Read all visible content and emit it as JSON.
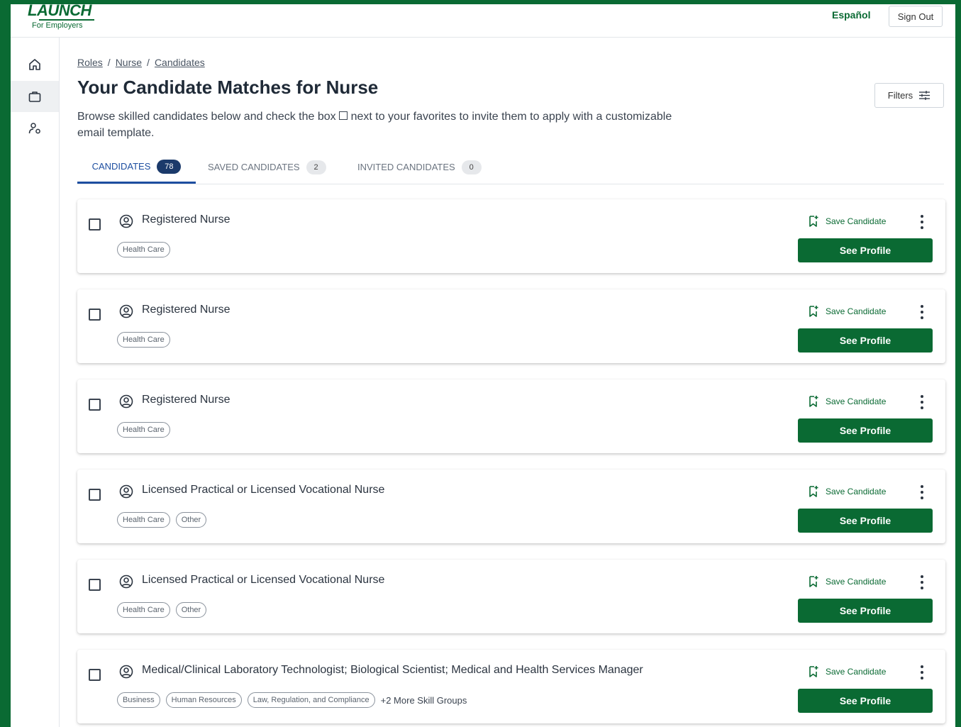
{
  "header": {
    "logo_text": "LAUNCH",
    "logo_subtitle": "For Employers",
    "language_link": "Español",
    "sign_out_label": "Sign Out"
  },
  "sidebar": {
    "items": [
      {
        "icon": "home-icon",
        "active": false
      },
      {
        "icon": "briefcase-icon",
        "active": true
      },
      {
        "icon": "user-settings-icon",
        "active": false
      }
    ]
  },
  "breadcrumb": {
    "items": [
      "Roles",
      "Nurse",
      "Candidates"
    ],
    "separator": "/"
  },
  "page": {
    "title": "Your Candidate Matches for Nurse",
    "description_before": "Browse skilled candidates below and check the box",
    "description_after": "next to your favorites to invite them to apply with a customizable email template.",
    "filters_label": "Filters"
  },
  "tabs": [
    {
      "label": "CANDIDATES",
      "count": "78",
      "active": true
    },
    {
      "label": "SAVED CANDIDATES",
      "count": "2",
      "active": false
    },
    {
      "label": "INVITED CANDIDATES",
      "count": "0",
      "active": false
    }
  ],
  "card_actions": {
    "save_label": "Save Candidate",
    "profile_label": "See Profile"
  },
  "candidates": [
    {
      "title": "Registered Nurse",
      "tags": [
        "Health Care"
      ],
      "more": ""
    },
    {
      "title": "Registered Nurse",
      "tags": [
        "Health Care"
      ],
      "more": ""
    },
    {
      "title": "Registered Nurse",
      "tags": [
        "Health Care"
      ],
      "more": ""
    },
    {
      "title": "Licensed Practical or Licensed Vocational Nurse",
      "tags": [
        "Health Care",
        "Other"
      ],
      "more": ""
    },
    {
      "title": "Licensed Practical or Licensed Vocational Nurse",
      "tags": [
        "Health Care",
        "Other"
      ],
      "more": ""
    },
    {
      "title": "Medical/Clinical Laboratory Technologist; Biological Scientist; Medical and Health Services Manager",
      "tags": [
        "Business",
        "Human Resources",
        "Law, Regulation, and Compliance"
      ],
      "more": "+2 More Skill Groups"
    }
  ],
  "colors": {
    "brand_green": "#0a6a33",
    "tab_active_blue": "#1d4ea0",
    "badge_navy": "#1b3a6b"
  }
}
